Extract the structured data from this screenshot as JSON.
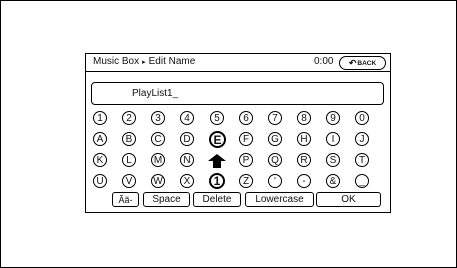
{
  "header": {
    "app": "Music Box",
    "separator": "▸",
    "page": "Edit Name",
    "time": "0:00",
    "back_label": "BACK",
    "back_icon": "↶"
  },
  "name_field": {
    "value": "PlayList1_"
  },
  "keyboard": {
    "rows": [
      [
        "1",
        "2",
        "3",
        "4",
        "5",
        "6",
        "7",
        "8",
        "9",
        "0"
      ],
      [
        "A",
        "B",
        "C",
        "D",
        "E",
        "F",
        "G",
        "H",
        "I",
        "J"
      ],
      [
        "K",
        "L",
        "M",
        "N",
        "⬆",
        "P",
        "Q",
        "R",
        "S",
        "T"
      ],
      [
        "U",
        "V",
        "W",
        "X",
        "1",
        "Z",
        "'",
        "-",
        "&",
        "_"
      ]
    ],
    "selected_key": "E"
  },
  "buttons": {
    "accent": "Ãã-",
    "space": "Space",
    "delete": "Delete",
    "case": "Lowercase",
    "ok": "OK"
  }
}
